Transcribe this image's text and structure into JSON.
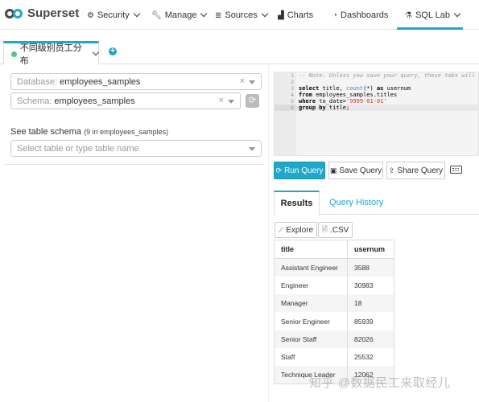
{
  "navbar": {
    "brand": "Superset",
    "items": [
      {
        "label": "Security",
        "icon": "gear-icon"
      },
      {
        "label": "Manage",
        "icon": "wrench-icon"
      },
      {
        "label": "Sources",
        "icon": "database-icon"
      },
      {
        "label": "Charts",
        "icon": "bar-chart-icon"
      },
      {
        "label": "Dashboards",
        "icon": "dashboard-icon"
      },
      {
        "label": "SQL Lab",
        "icon": "flask-icon"
      }
    ]
  },
  "query_tabs": {
    "active_label": "不同级别员工分布",
    "add_label": "+"
  },
  "left_panel": {
    "database_label": "Database:",
    "database_value": "employees_samples",
    "schema_label": "Schema:",
    "schema_value": "employees_samples",
    "clear_symbol": "×",
    "see_schema_label": "See table schema",
    "table_count": "(9 in employees_samples)",
    "table_placeholder": "Select table or type table name"
  },
  "editor": {
    "line_numbers": [
      "1",
      "2",
      "3",
      "4",
      "5",
      "6"
    ],
    "comment": "-- Note: Unless you save your query, these tabs will NOT persist",
    "sql_line1_kw": "select",
    "sql_line1_a": " title, ",
    "sql_line1_fn": "count",
    "sql_line1_b": "(*) ",
    "sql_line1_kw2": "as",
    "sql_line1_c": " usernum",
    "sql_line2_kw": "from",
    "sql_line2_a": " employees_samples.titles",
    "sql_line3_kw": "where",
    "sql_line3_a": " to_date=",
    "sql_line3_str": "'9999-01-01'",
    "sql_line4_kw": "group by",
    "sql_line4_a": " title;"
  },
  "toolbar": {
    "run_label": "Run Query",
    "save_label": "Save Query",
    "share_label": "Share Query"
  },
  "results_tabs": {
    "results_label": "Results",
    "history_label": "Query History"
  },
  "results_actions": {
    "explore_label": "Explore",
    "csv_label": ".CSV"
  },
  "table": {
    "columns": [
      "title",
      "usernum"
    ],
    "rows": [
      [
        "Assistant Engineer",
        "3588"
      ],
      [
        "Engineer",
        "30983"
      ],
      [
        "Manager",
        "18"
      ],
      [
        "Senior Engineer",
        "85939"
      ],
      [
        "Senior Staff",
        "82026"
      ],
      [
        "Staff",
        "25532"
      ],
      [
        "Technique Leader",
        "12062"
      ]
    ]
  },
  "watermark": "知乎 @数据民工来取经儿",
  "colors": {
    "accent": "#20a7c9",
    "status_green": "#5ac189"
  }
}
